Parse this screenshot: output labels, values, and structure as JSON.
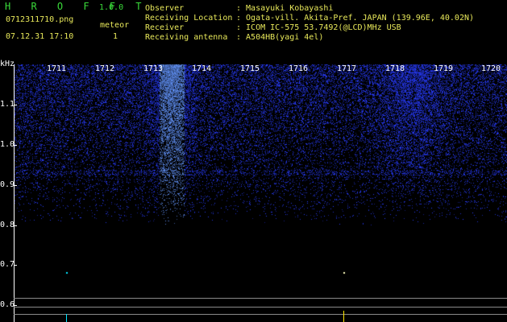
{
  "app": {
    "title": "H R O F F T",
    "version": "1.0.0",
    "filename": "0712311710.png",
    "timestamp": "07.12.31 17:10",
    "meteor_label": "meteor",
    "meteor_count": "1"
  },
  "info": {
    "labels": [
      "Observer",
      "Receiving Location",
      "Receiver",
      "Receiving antenna"
    ],
    "values": [
      ": Masayuki Kobayashi",
      ": Ogata-vill. Akita-Pref. JAPAN (139.96E, 40.02N)",
      ": ICOM IC-575 53.7492(@LCD)MHz USB",
      ": A504HB(yagi 4el)"
    ]
  },
  "axes": {
    "y_unit": "kHz",
    "y_ticks": [
      "1.1",
      "1.0",
      "0.9",
      "0.8",
      "0.7",
      "0.6"
    ],
    "time_labels": [
      "1711",
      "1712",
      "1713",
      "1714",
      "1715",
      "1716",
      "1717",
      "1718",
      "1719",
      "1720"
    ]
  },
  "colors": {
    "background": "#000000",
    "text_yellow": "#e8e85a",
    "text_green": "#3adb3a",
    "noise_blue": "#1a33cc",
    "marker_yellow": "#ffe600",
    "marker_cyan": "#00e5ff"
  }
}
